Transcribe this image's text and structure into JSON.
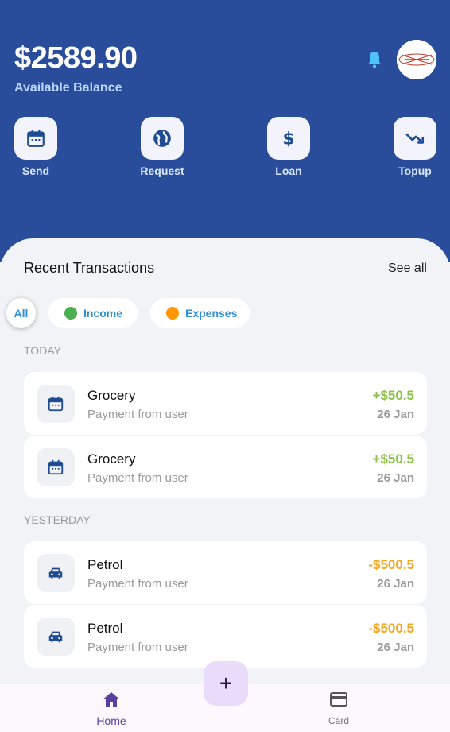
{
  "header": {
    "balance": "$2589.90",
    "balance_label": "Available Balance",
    "icons": {
      "notifications": "bell-icon",
      "profile": "avatar"
    }
  },
  "actions": [
    {
      "label": "Send",
      "icon": "calendar-icon"
    },
    {
      "label": "Request",
      "icon": "globe-icon"
    },
    {
      "label": "Loan",
      "icon": "dollar-icon"
    },
    {
      "label": "Topup",
      "icon": "trending-down-icon"
    }
  ],
  "transactions": {
    "title": "Recent Transactions",
    "see_all": "See all",
    "filters": [
      {
        "label": "All",
        "selected": true
      },
      {
        "label": "Income",
        "dot_color": "#4caf50"
      },
      {
        "label": "Expenses",
        "dot_color": "#ff9800"
      }
    ],
    "groups": [
      {
        "label": "TODAY",
        "items": [
          {
            "name": "Grocery",
            "subtitle": "Payment from user",
            "amount": "+$50.5",
            "date": "26 Jan",
            "icon": "calendar-icon"
          },
          {
            "name": "Grocery",
            "subtitle": "Payment from user",
            "amount": "+$50.5",
            "date": "26 Jan",
            "icon": "calendar-icon"
          }
        ]
      },
      {
        "label": "YESTERDAY",
        "items": [
          {
            "name": "Petrol",
            "subtitle": "Payment from user",
            "amount": "-$500.5",
            "date": "26 Jan",
            "icon": "car-icon"
          },
          {
            "name": "Petrol",
            "subtitle": "Payment from user",
            "amount": "-$500.5",
            "date": "26 Jan",
            "icon": "car-icon"
          }
        ]
      }
    ]
  },
  "fab": {
    "label": "+"
  },
  "bottom_nav": [
    {
      "label": "Home",
      "icon": "home-icon",
      "active": true
    },
    {
      "label": "Card",
      "icon": "credit-card-icon",
      "active": false
    }
  ],
  "colors": {
    "header_bg": "#2a4d9b",
    "income": "#8bc34a",
    "expense": "#f5a623",
    "chip_text": "#2f8fd8",
    "nav_active": "#5b3fa0"
  }
}
